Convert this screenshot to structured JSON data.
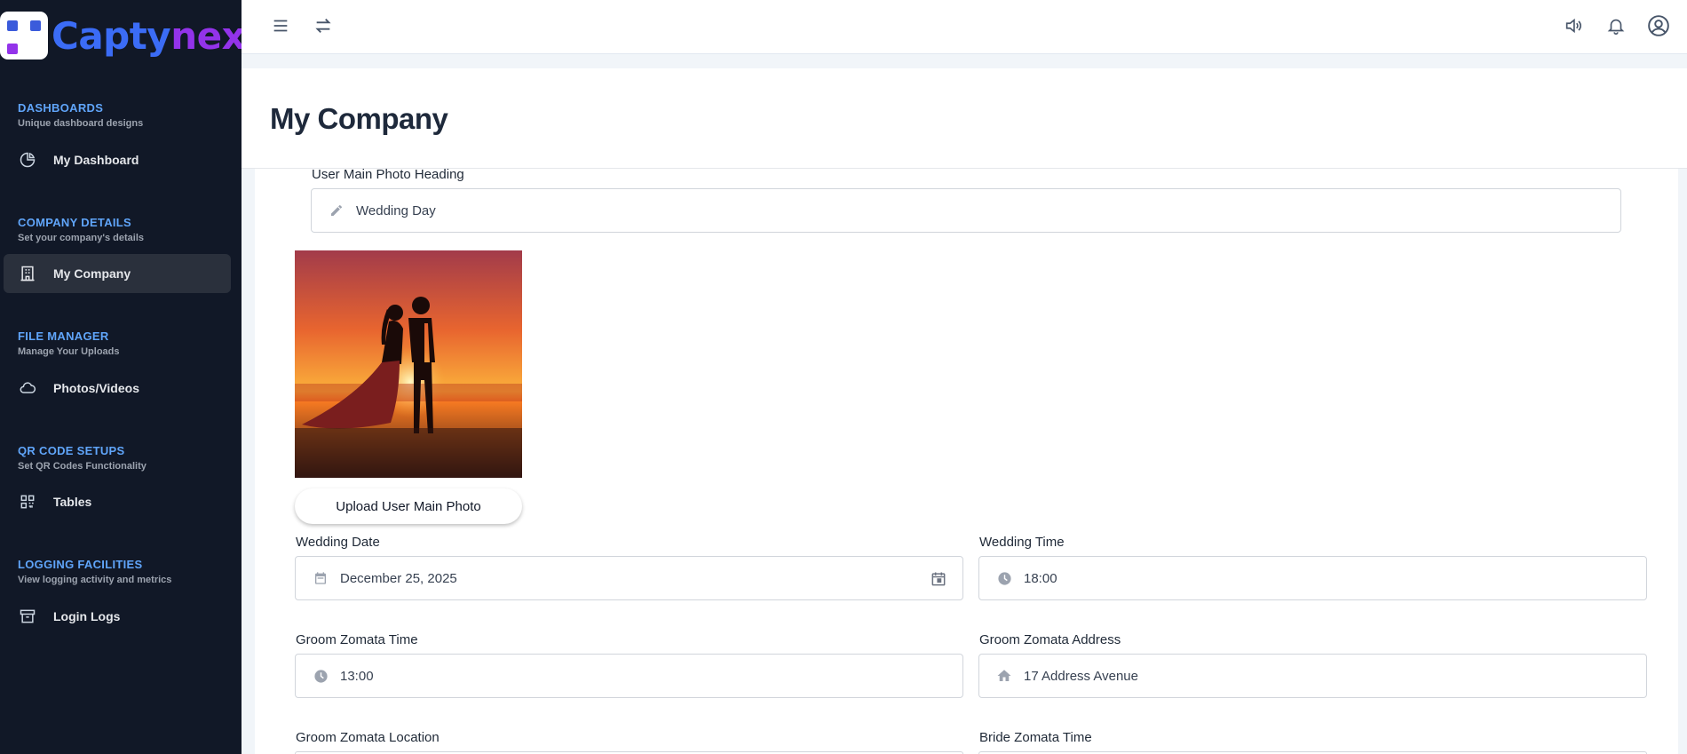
{
  "brand": {
    "part1": "Capty",
    "part2": "nex"
  },
  "sidebar": {
    "sections": [
      {
        "title": "DASHBOARDS",
        "subtitle": "Unique dashboard designs",
        "item": "My Dashboard",
        "icon": "pie-chart-icon"
      },
      {
        "title": "COMPANY DETAILS",
        "subtitle": "Set your company's details",
        "item": "My Company",
        "icon": "building-icon"
      },
      {
        "title": "FILE MANAGER",
        "subtitle": "Manage Your Uploads",
        "item": "Photos/Videos",
        "icon": "cloud-icon"
      },
      {
        "title": "QR CODE SETUPS",
        "subtitle": "Set QR Codes Functionality",
        "item": "Tables",
        "icon": "qr-code-icon"
      },
      {
        "title": "LOGGING FACILITIES",
        "subtitle": "View logging activity and metrics",
        "item": "Login Logs",
        "icon": "archive-icon"
      }
    ]
  },
  "topbar": {
    "icons": [
      "menu-icon",
      "swap-icon",
      "speaker-icon",
      "bell-icon",
      "user-circle-icon"
    ]
  },
  "page": {
    "title": "My Company"
  },
  "form": {
    "photo_heading": {
      "label": "User Main Photo Heading",
      "value": "Wedding Day"
    },
    "upload_button": "Upload User Main Photo",
    "wedding_date": {
      "label": "Wedding Date",
      "value": "December 25, 2025"
    },
    "wedding_time": {
      "label": "Wedding Time",
      "value": "18:00"
    },
    "groom_zomata_time": {
      "label": "Groom Zomata Time",
      "value": "13:00"
    },
    "groom_zomata_address": {
      "label": "Groom Zomata Address",
      "value": "17 Address Avenue"
    },
    "groom_zomata_location": {
      "label": "Groom Zomata Location"
    },
    "bride_zomata_time": {
      "label": "Bride Zomata Time"
    }
  },
  "colors": {
    "sidebar_bg": "#111827",
    "accent_blue": "#3b6cf6",
    "accent_purple": "#9333ea",
    "section_title": "#60a5fa"
  }
}
